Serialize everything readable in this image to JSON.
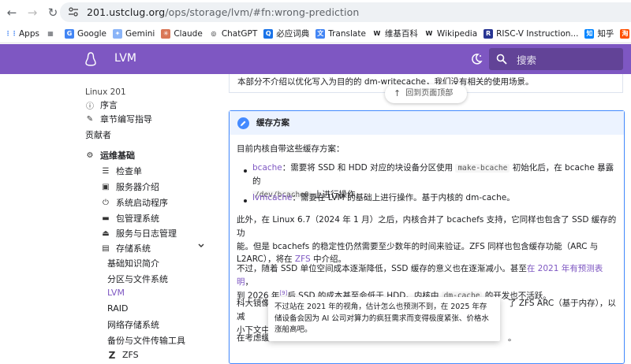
{
  "browser": {
    "url_host": "201.ustclug.org",
    "url_path": "/ops/storage/lvm/#fn:wrong-prediction",
    "bookmarks": [
      {
        "label": "Apps",
        "color": "#4285f4"
      },
      {
        "label": "",
        "color": "#5f6368"
      },
      {
        "label": "Google",
        "color": "#4285f4"
      },
      {
        "label": "Gemini",
        "color": "#8ab4f8"
      },
      {
        "label": "Claude",
        "color": "#d97757"
      },
      {
        "label": "ChatGPT",
        "color": "#202124"
      },
      {
        "label": "必应词典",
        "color": "#1a73e8"
      },
      {
        "label": "Translate",
        "color": "#4285f4"
      },
      {
        "label": "维基百科",
        "color": "#202124"
      },
      {
        "label": "Wikipedia",
        "color": "#202124"
      },
      {
        "label": "RISC-V Instruction...",
        "color": "#283593"
      },
      {
        "label": "知乎",
        "color": "#0084ff"
      },
      {
        "label": "淘宝网",
        "color": "#ff5000"
      }
    ]
  },
  "header": {
    "title": "LVM",
    "search_placeholder": "搜索",
    "accent": "#7e57c2"
  },
  "sidebar": {
    "site_name": "Linux 201",
    "items": [
      {
        "label": "序言",
        "icon": "info-icon"
      },
      {
        "label": "章节编写指导",
        "icon": "pen-icon"
      },
      {
        "label": "贡献者",
        "icon": ""
      },
      {
        "label": "运维基础",
        "icon": "gear-icon"
      },
      {
        "label": "检查单",
        "icon": "checklist-icon"
      },
      {
        "label": "服务器介绍",
        "icon": "server-icon"
      },
      {
        "label": "系统启动程序",
        "icon": "power-icon"
      },
      {
        "label": "包管理系统",
        "icon": "package-icon"
      },
      {
        "label": "服务与日志管理",
        "icon": "eject-icon"
      },
      {
        "label": "存储系统",
        "icon": "storage-icon"
      },
      {
        "label": "基础知识简介",
        "icon": ""
      },
      {
        "label": "分区与文件系统",
        "icon": ""
      },
      {
        "label": "LVM",
        "icon": ""
      },
      {
        "label": "RAID",
        "icon": ""
      },
      {
        "label": "网络存储系统",
        "icon": ""
      },
      {
        "label": "备份与文件传输工具",
        "icon": ""
      },
      {
        "label": "ZFS",
        "icon": "zfs-icon"
      }
    ]
  },
  "main": {
    "prev_text": "本部分不介绍以优化写入为目的的 dm-writecache，我们没有相关的使用场景。",
    "back_to_top": "回到页面顶部",
    "admonition_title": "缓存方案",
    "intro": "目前内核自带这些缓存方案：",
    "b1_link": "bcache",
    "b1_a": "：需要将 SSD 和 HDD 对应的块设备分区使用",
    "b1_code1": "make-bcache",
    "b1_b": "初始化后，在 bcache 暴露的",
    "b1_code2": "/dev/bcache0",
    "b1_c": "上进行操作。",
    "b2_link": "lvmcache",
    "b2_a": "：需要在 LVM 的基础上进行操作。基于内核的 dm-cache。",
    "p3_a": "此外，在 Linux 6.7（2024 年 1 月）之后，内核合并了 bcachefs 支持，它同样也包含了 SSD 缓存的功",
    "p3_b": "能。但是 bcachefs 的稳定性仍然需要至少数年的时间来验证。ZFS 同样也包含缓存功能（ARC 与",
    "p3_c": "L2ARC），将在",
    "p3_link": "ZFS",
    "p3_d": "中介绍。",
    "p4_a": "不过，随着 SSD 单位空间成本逐渐降低，SSD 缓存的意义也在逐渐减小。甚至",
    "p4_link": "在 2021 年有预测表明",
    "p4_b": "，",
    "p4_c": "到 2026 年",
    "p4_sup": "[9]",
    "p4_d": "后 SSD 的成本甚至会低于 HDD。内核中",
    "p4_code": "dm-cache",
    "p4_e": "的开发也不活跃。",
    "p5_a": "科大镜像",
    "p5_b": "了 ZFS ARC（基于内存），以减",
    "p5_c": "小下文中",
    "p6_a": "在考虑缓",
    "p6_b": "。"
  },
  "tooltip": {
    "text": "不过站在 2021 年的视角，估计怎么也预测不到，在 2025 年存储设备会因为 AI 公司对算力的疯狂需求而变得极度紧张、价格水涨船高吧。"
  }
}
